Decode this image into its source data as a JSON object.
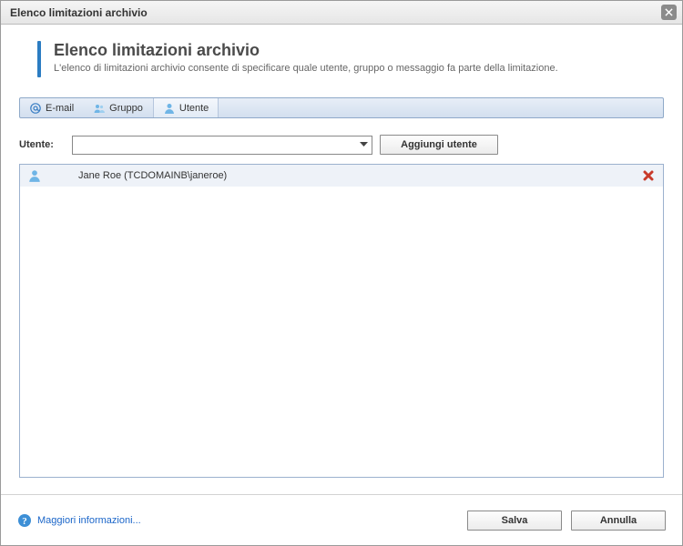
{
  "window": {
    "title": "Elenco limitazioni archivio"
  },
  "header": {
    "title": "Elenco limitazioni archivio",
    "subtitle": "L'elenco di limitazioni archivio consente di specificare quale utente, gruppo o messaggio fa parte della limitazione."
  },
  "tabs": {
    "email": "E-mail",
    "group": "Gruppo",
    "user": "Utente",
    "active": "user"
  },
  "form": {
    "user_label": "Utente:",
    "user_value": "",
    "add_user_label": "Aggiungi utente"
  },
  "list": {
    "rows": [
      {
        "text": "Jane Roe (TCDOMAINB\\janeroe)"
      }
    ]
  },
  "footer": {
    "more_info": "Maggiori informazioni...",
    "save": "Salva",
    "cancel": "Annulla"
  }
}
